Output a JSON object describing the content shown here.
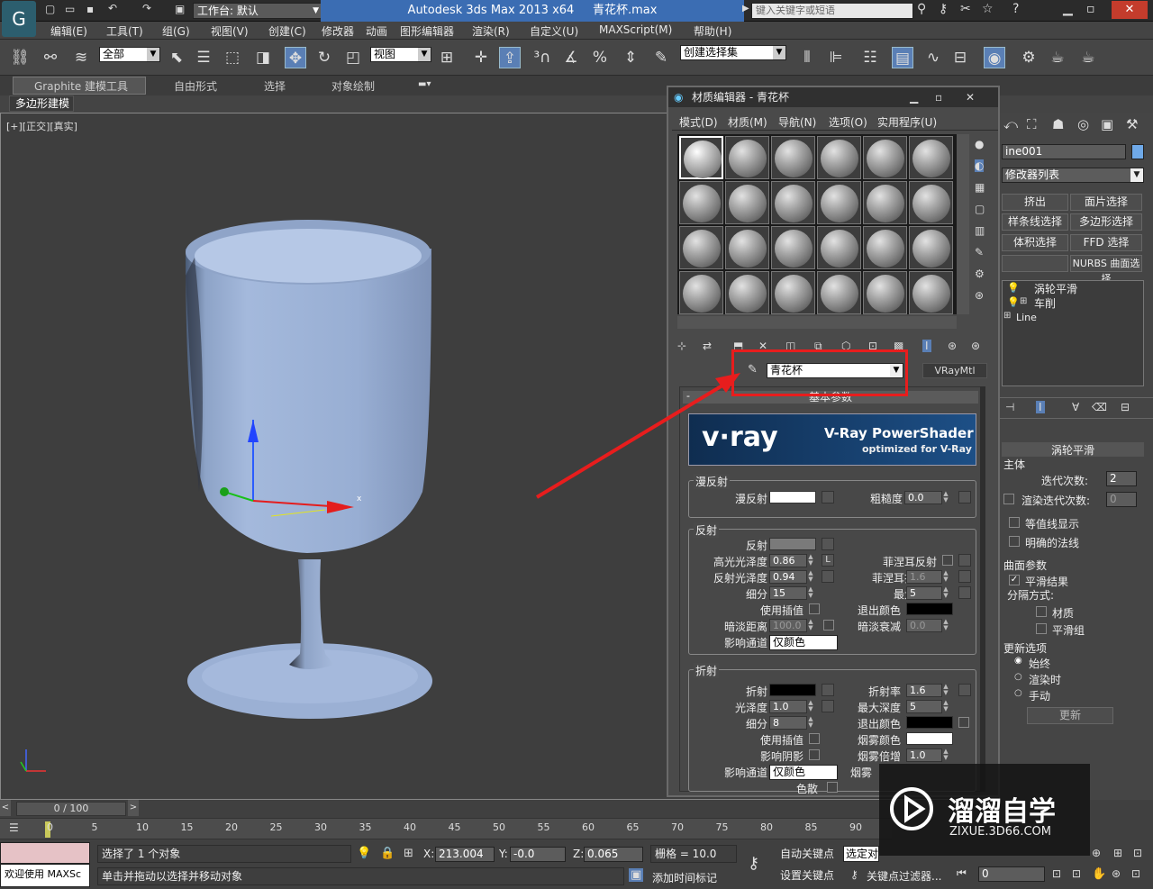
{
  "window": {
    "app_title": "Autodesk 3ds Max  2013 x64",
    "file_name": "青花杯.max",
    "workspace": "工作台: 默认",
    "search_placeholder": "键入关键字或短语"
  },
  "menubar": [
    "编辑(E)",
    "工具(T)",
    "组(G)",
    "视图(V)",
    "创建(C)",
    "修改器",
    "动画",
    "图形编辑器",
    "渲染(R)",
    "自定义(U)",
    "MAXScript(M)",
    "帮助(H)"
  ],
  "toolbar": {
    "selection_filter": "全部",
    "ref_coord": "视图",
    "named_selection": "创建选择集"
  },
  "ribbon": {
    "tabs": [
      "Graphite 建模工具",
      "自由形式",
      "选择",
      "对象绘制"
    ],
    "sub_tab": "多边形建模"
  },
  "viewport": {
    "label": "[+][正交][真实]",
    "gizmo_axis_x": "x"
  },
  "material_editor": {
    "title": "材质编辑器 - 青花杯",
    "menu": [
      "模式(D)",
      "材质(M)",
      "导航(N)",
      "选项(O)",
      "实用程序(U)"
    ],
    "material_name": "青花杯",
    "material_type": "VRayMtl",
    "rollout_title": "基本参数",
    "vray_banner": {
      "logo": "v·ray",
      "title": "V-Ray PowerShader",
      "subtitle": "optimized for V-Ray"
    },
    "diffuse": {
      "group": "漫反射",
      "diffuse_label": "漫反射",
      "roughness_label": "粗糙度",
      "roughness": "0.0",
      "diffuse_color": "#ffffff"
    },
    "reflection": {
      "group": "反射",
      "reflect_label": "反射",
      "reflect_color": "#7a7a7a",
      "hilight_gloss_label": "高光光泽度",
      "hilight_gloss": "0.86",
      "l_button": "L",
      "fresnel_label": "菲涅耳反射",
      "fresnel_ior_label": "菲涅耳折射率",
      "fresnel_ior": "1.6",
      "refl_gloss_label": "反射光泽度",
      "refl_gloss": "0.94",
      "subdivs_label": "细分",
      "subdivs": "15",
      "max_depth_label": "最大深度",
      "max_depth": "5",
      "use_interp_label": "使用插值",
      "exit_color_label": "退出颜色",
      "exit_color": "#000000",
      "dim_dist_label": "暗淡距离",
      "dim_dist": "100.0",
      "dim_falloff_label": "暗淡衰减",
      "dim_falloff": "0.0",
      "affect_channels_label": "影响通道",
      "affect_channels": "仅颜色"
    },
    "refraction": {
      "group": "折射",
      "refract_label": "折射",
      "refract_color": "#000000",
      "ior_label": "折射率",
      "ior": "1.6",
      "gloss_label": "光泽度",
      "gloss": "1.0",
      "max_depth_label": "最大深度",
      "max_depth": "5",
      "subdivs_label": "细分",
      "subdivs": "8",
      "exit_color_label": "退出颜色",
      "exit_color": "#000000",
      "use_interp_label": "使用插值",
      "fog_color_label": "烟雾颜色",
      "fog_color": "#ffffff",
      "affect_shadows_label": "影响阴影",
      "fog_mult_label": "烟雾倍增",
      "fog_mult": "1.0",
      "affect_channels_label": "影响通道",
      "affect_channels": "仅颜色",
      "fog_bias_label": "烟雾",
      "dispersion_label": "色散"
    }
  },
  "command_panel": {
    "object_name": "ine001",
    "modifier_list": "修改器列表",
    "buttons": [
      "挤出",
      "面片选择",
      "样条线选择",
      "多边形选择",
      "体积选择",
      "FFD 选择",
      "",
      "NURBS 曲面选择"
    ],
    "stack": [
      "涡轮平滑",
      "车削",
      "Line"
    ],
    "turbosmooth_title": "涡轮平滑",
    "main_label": "主体",
    "iterations_label": "迭代次数:",
    "iterations": "2",
    "render_iters_label": "渲染迭代次数:",
    "render_iters": "0",
    "isoline_label": "等值线显示",
    "explicit_normals_label": "明确的法线",
    "surface_params_label": "曲面参数",
    "smooth_result_label": "平滑结果",
    "separate_by_label": "分隔方式:",
    "materials_label": "材质",
    "smoothing_groups_label": "平滑组",
    "update_options_label": "更新选项",
    "always_label": "始终",
    "when_rendering_label": "渲染时",
    "manually_label": "手动",
    "update_button": "更新"
  },
  "timeline": {
    "frame_display": "0 / 100",
    "ticks": [
      "0",
      "5",
      "10",
      "15",
      "20",
      "25",
      "30",
      "35",
      "40",
      "45",
      "50",
      "55",
      "60",
      "65",
      "70",
      "75",
      "80",
      "85",
      "90"
    ]
  },
  "status": {
    "maxscript_label": "欢迎使用 MAXSc",
    "selected_text": "选择了 1 个对象",
    "prompt_text": "单击并拖动以选择并移动对象",
    "x_label": "X:",
    "x": "213.004",
    "y_label": "Y:",
    "y": "-0.0",
    "z_label": "Z:",
    "z": "0.065",
    "grid": "栅格 = 10.0",
    "add_time_tag": "添加时间标记",
    "auto_key": "自动关键点",
    "set_key": "设置关键点",
    "selected_dd": "选定对",
    "key_filters": "关键点过滤器...",
    "current_frame": "0"
  },
  "watermark": {
    "brand": "溜溜自学",
    "url": "ZIXUE.3D66.COM"
  }
}
